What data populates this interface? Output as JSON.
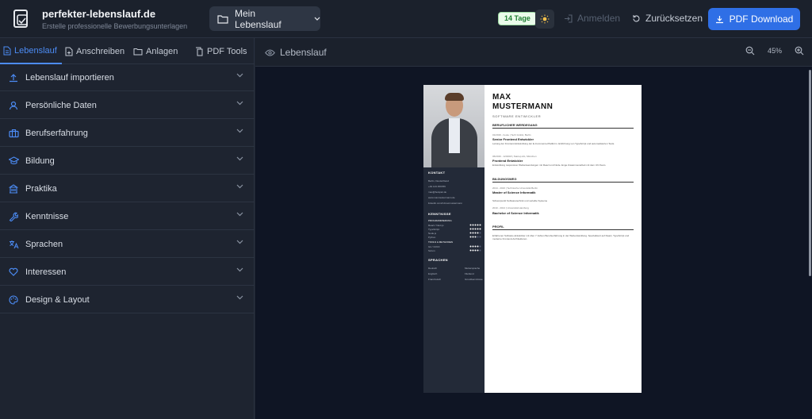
{
  "header": {
    "brand": "perfekter-lebenslauf.de",
    "tagline": "Erstelle professionelle Bewerbungsunterlagen",
    "doc_select": "Mein Lebenslauf",
    "days_badge": "14 Tage",
    "login": "Anmelden",
    "reset": "Zurücksetzen",
    "pdf_download": "PDF Download",
    "accent_color": "#2f6fe6"
  },
  "sidebar": {
    "tabs": [
      {
        "label": "Lebenslauf",
        "icon": "document-icon",
        "active": true
      },
      {
        "label": "Anschreiben",
        "icon": "document-plus-icon",
        "active": false
      },
      {
        "label": "Anlagen",
        "icon": "folder-icon",
        "active": false
      },
      {
        "label": "PDF Tools",
        "icon": "copy-icon",
        "active": false
      }
    ],
    "sections": [
      {
        "label": "Lebenslauf importieren",
        "icon": "upload-icon"
      },
      {
        "label": "Persönliche Daten",
        "icon": "user-icon"
      },
      {
        "label": "Berufserfahrung",
        "icon": "briefcase-icon"
      },
      {
        "label": "Bildung",
        "icon": "graduation-cap-icon"
      },
      {
        "label": "Praktika",
        "icon": "building-icon"
      },
      {
        "label": "Kenntnisse",
        "icon": "wrench-icon"
      },
      {
        "label": "Sprachen",
        "icon": "translate-icon"
      },
      {
        "label": "Interessen",
        "icon": "heart-icon"
      },
      {
        "label": "Design & Layout",
        "icon": "palette-icon"
      }
    ]
  },
  "preview": {
    "label": "Lebenslauf",
    "zoom": "45%"
  },
  "resume": {
    "first_name": "MAX",
    "last_name": "MUSTERMANN",
    "subtitle": "SOFTWARE ENTWICKLER",
    "section_experience": "BERUFLICHER WERDEGANG",
    "job1_meta": "01/2019 - heute  |  Tech GmbH, Berlin",
    "job1_title": "Senior Frontend Entwickler",
    "job1_text": "Leitung der Frontend-Entwicklung der E-Commerce-Plattform. Einführung von TypeScript und automatisierten Tests.",
    "job2_meta": "06/2016 - 12/2018  |  Startup AG, München",
    "job2_title": "Frontend Entwickler",
    "job2_text": "Entwicklung responsiver Webanwendungen mit React und Node. Enge Zusammenarbeit mit dem UX-Team.",
    "section_education": "BILDUNGSWEG",
    "edu1_meta": "2014 - 2016  |  Technische Universität Berlin",
    "edu1_title": "Master of Science Informatik",
    "edu1_text": "Schwerpunkt Softwaretechnik und verteilte Systeme",
    "edu2_meta": "2010 - 2014  |  Universität Hamburg",
    "edu2_title": "Bachelor of Science Informatik",
    "section_profile": "PROFIL",
    "profile_text": "Erfahrener Software-Entwickler mit über 7 Jahren Berufserfahrung in der Webentwicklung. Spezialisiert auf React, TypeScript und moderne Frontend-Architekturen.",
    "contact_heading": "KONTAKT",
    "contact": [
      "Berlin, Deutschland",
      "+49 123 456789",
      "max@beispiel.de",
      "www.maxmustermann.de",
      "linkedin.com/in/maxmustermann"
    ],
    "skills_heading": "KENNTNISSE",
    "skills_sub1": "PROGRAMMIERUNG",
    "skills": [
      {
        "name": "React / Next.js",
        "level": 5
      },
      {
        "name": "TypeScript",
        "level": 5
      },
      {
        "name": "Node.js",
        "level": 4
      },
      {
        "name": "Python",
        "level": 3
      }
    ],
    "skills_sub2": "TOOLS & METHODEN",
    "tools": [
      {
        "name": "Git / CI/CD",
        "level": 4
      },
      {
        "name": "Scrum",
        "level": 4
      }
    ],
    "lang_heading": "SPRACHEN",
    "languages": [
      {
        "name": "Deutsch",
        "level": "Muttersprache"
      },
      {
        "name": "Englisch",
        "level": "Fließend"
      },
      {
        "name": "Französisch",
        "level": "Grundkenntnisse"
      }
    ]
  }
}
